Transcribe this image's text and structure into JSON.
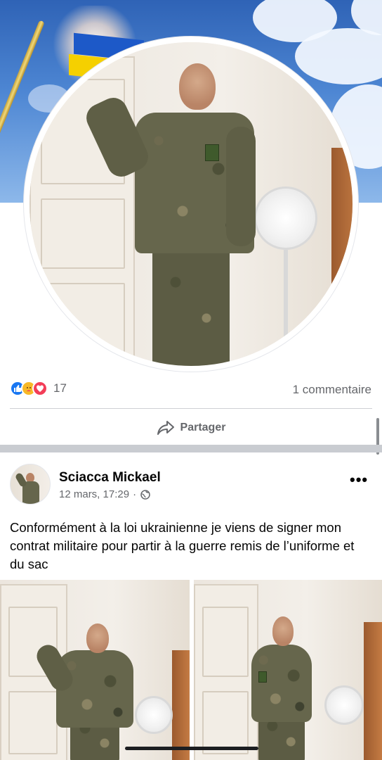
{
  "post_stats": {
    "reactions": [
      "like-icon",
      "care-icon",
      "love-icon"
    ],
    "reaction_count": "17",
    "comment_count": "1 commentaire"
  },
  "actions": {
    "share_label": "Partager"
  },
  "post": {
    "author": "Sciacca Mickael",
    "timestamp": "12 mars, 17:29",
    "separator": "·",
    "privacy_icon": "globe-icon",
    "more_label": "•••",
    "text": "Conformément à la loi ukrainienne je viens de signer mon contrat militaire pour partir à la guerre remis de l’uniforme et du sac"
  },
  "colors": {
    "like": "#1877f2",
    "love": "#f33e58",
    "care": "#f7b928",
    "secondary_text": "#65676b"
  }
}
